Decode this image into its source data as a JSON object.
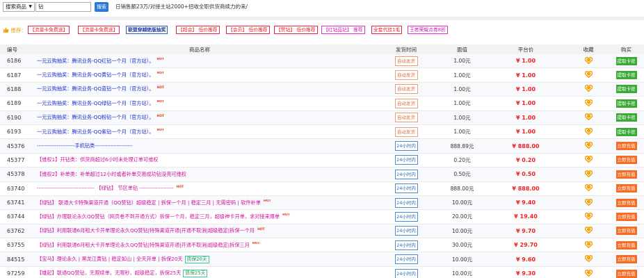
{
  "topbar": {
    "select_value": "搜索商品",
    "search_value": "钻",
    "search_button": "搜索",
    "stats": "日销售额23万/对接主站2000+招收全职供货商续力的来/"
  },
  "recommend": {
    "icon": "thumbs-up-icon",
    "label": "推荐：",
    "tags": [
      {
        "label": "【流量卡免费送】",
        "style": "red"
      },
      {
        "label": "【流量卡免费送】",
        "style": "red"
      },
      {
        "label": "联盟穿越绝版抽奖",
        "style": "blue"
      },
      {
        "label": "【超会】 低价推荐",
        "style": "red"
      },
      {
        "label": "【会员】 低价推荐",
        "style": "red"
      },
      {
        "label": "【赞钻】 低价推荐",
        "style": "red"
      },
      {
        "label": "【红钻蓝钻】 推荐",
        "style": "pink"
      },
      {
        "label": "全套代挂1毛",
        "style": "red"
      },
      {
        "label": "王者荣耀点券8折",
        "style": "pink"
      }
    ]
  },
  "table": {
    "headers": {
      "id": "编号",
      "name": "商品名称",
      "time": "发货时间",
      "face": "面值",
      "price": "平台价",
      "fav": "收藏",
      "buy": "购买"
    },
    "rows": [
      {
        "id": "6186",
        "name": "一元云购抽奖：腾讯业务-QQ红钻一个月（官方站）。",
        "hot": "HOT",
        "badge": "",
        "color": "blue",
        "time": "自动发货",
        "time_style": "auto",
        "face": "1.00元",
        "price": "¥ 1.00",
        "buy": "提取卡密",
        "buy_style": "green"
      },
      {
        "id": "6187",
        "name": "一元云购抽奖：腾讯业务-QQ黄钻一个月（官方站）。",
        "hot": "HOT",
        "badge": "",
        "color": "blue",
        "time": "自动发货",
        "time_style": "auto",
        "face": "1.00元",
        "price": "¥ 1.00",
        "buy": "提取卡密",
        "buy_style": "green"
      },
      {
        "id": "6188",
        "name": "一元云购抽奖：腾讯业务-QQ蓝钻一个月（官方站）。",
        "hot": "HOT",
        "badge": "",
        "color": "blue",
        "time": "自动发货",
        "time_style": "auto",
        "face": "1.00元",
        "price": "¥ 1.00",
        "buy": "提取卡密",
        "buy_style": "green"
      },
      {
        "id": "6189",
        "name": "一元云购抽奖：腾讯业务-QQ绿钻一个月（官方站）。",
        "hot": "HOT",
        "badge": "",
        "color": "blue",
        "time": "自动发货",
        "time_style": "auto",
        "face": "1.00元",
        "price": "¥ 1.00",
        "buy": "提取卡密",
        "buy_style": "green"
      },
      {
        "id": "6190",
        "name": "一元云购抽奖：腾讯业务-QQ粉钻一个月（官方站）。",
        "hot": "HOT",
        "badge": "",
        "color": "blue",
        "time": "自动发货",
        "time_style": "auto",
        "face": "1.00元",
        "price": "¥ 1.00",
        "buy": "提取卡密",
        "buy_style": "green"
      },
      {
        "id": "6193",
        "name": "一元云购抽奖：腾讯业务-QQ紫钻一个月（官方站）。",
        "hot": "HOT",
        "badge": "",
        "color": "blue",
        "time": "自动发货",
        "time_style": "auto",
        "face": "1.00元",
        "price": "¥ 1.00",
        "buy": "提取卡密",
        "buy_style": "green"
      },
      {
        "id": "45376",
        "name": "---------------------手机钻类---------------------",
        "hot": "",
        "badge": "",
        "color": "blue",
        "time": "24小时内",
        "time_style": "24",
        "face": "888.89元",
        "price": "¥ 888.00",
        "buy": "立即充值",
        "buy_style": "orange"
      },
      {
        "id": "45377",
        "name": "【维权1】开钻类：供货商超过6小时未处理订单可维权",
        "hot": "",
        "badge": "",
        "color": "pink",
        "time": "24小时内",
        "time_style": "24",
        "face": "0.20元",
        "price": "¥ 0.20",
        "buy": "立即充值",
        "buy_style": "orange"
      },
      {
        "id": "45378",
        "name": "【维权2】补单类：补单超过12小时或者补单交易成功钻没亮可维权",
        "hot": "",
        "badge": "",
        "color": "pink",
        "time": "24小时内",
        "time_style": "24",
        "face": "0.50元",
        "price": "¥ 0.50",
        "buy": "立即充值",
        "buy_style": "orange"
      },
      {
        "id": "63740",
        "name": "-------------------------------- 【绿钻】 节区单钻 -------------------",
        "hot": "HOT",
        "badge": "",
        "color": "pink",
        "time": "24小时内",
        "time_style": "24",
        "face": "888.00元",
        "price": "¥ 888.00",
        "buy": "立即充值",
        "buy_style": "orange"
      },
      {
        "id": "63741",
        "name": "【绿钻】 联通大卡特殊渠道开通（QQ赞钻）超级稳定 | 拆保一个月 | 稳定三月 | 无需密码 | 软件补单",
        "hot": "HOT",
        "badge": "",
        "color": "pink",
        "time": "24小时内",
        "time_style": "24",
        "face": "10.00元",
        "price": "¥ 9.40",
        "buy": "立即充值",
        "buy_style": "orange"
      },
      {
        "id": "63744",
        "name": "【绿钻】办理联论永久QQ赞钻（网页卷不到开通方式）拆保一个月，稳定三月，超级神卡开单，求对接来爆单",
        "hot": "HOT",
        "badge": "",
        "color": "pink",
        "time": "24小时内",
        "time_style": "24",
        "face": "20.00元",
        "price": "¥ 19.40",
        "buy": "立即充值",
        "buy_style": "orange"
      },
      {
        "id": "63762",
        "name": "【绿钻】利用联通6月租大卡开单理论永久QQ赞钻|特殊渠道开通|开通不取消|超级稳定|拆保一个月",
        "hot": "HOT",
        "badge": "",
        "color": "pink",
        "time": "24小时内",
        "time_style": "24",
        "face": "10.00元",
        "price": "¥ 9.70",
        "buy": "立即充值",
        "buy_style": "orange"
      },
      {
        "id": "63755",
        "name": "【绿钻】利用联通6月租大卡开单理论永久QQ赞钻|特殊渠道开通|开通不取消|超级稳定|拆保三月",
        "hot": "HOT",
        "badge": "",
        "color": "pink",
        "time": "24小时内",
        "time_style": "24",
        "face": "30.00元",
        "price": "¥ 29.70",
        "buy": "立即充值",
        "buy_style": "orange"
      },
      {
        "id": "84515",
        "name": "【宝马】理论永久 | 黑龙江黄钻 | 稳定如山 | 全天开单 | 拆保20天",
        "hot": "",
        "badge": "质保20天",
        "color": "pink",
        "time": "24小时内",
        "time_style": "24",
        "face": "10.00元",
        "price": "¥ 9.60",
        "buy": "立即充值",
        "buy_style": "orange"
      },
      {
        "id": "97259",
        "name": "【雄起】联通QQ赞钻，无限续单，无限秒，超级稳定，拆保25天",
        "hot": "",
        "badge": "质保25天",
        "color": "pink",
        "time": "24小时内",
        "time_style": "24",
        "face": "10.00元",
        "price": "¥ 9.30",
        "buy": "立即充值",
        "buy_style": "orange"
      }
    ]
  }
}
